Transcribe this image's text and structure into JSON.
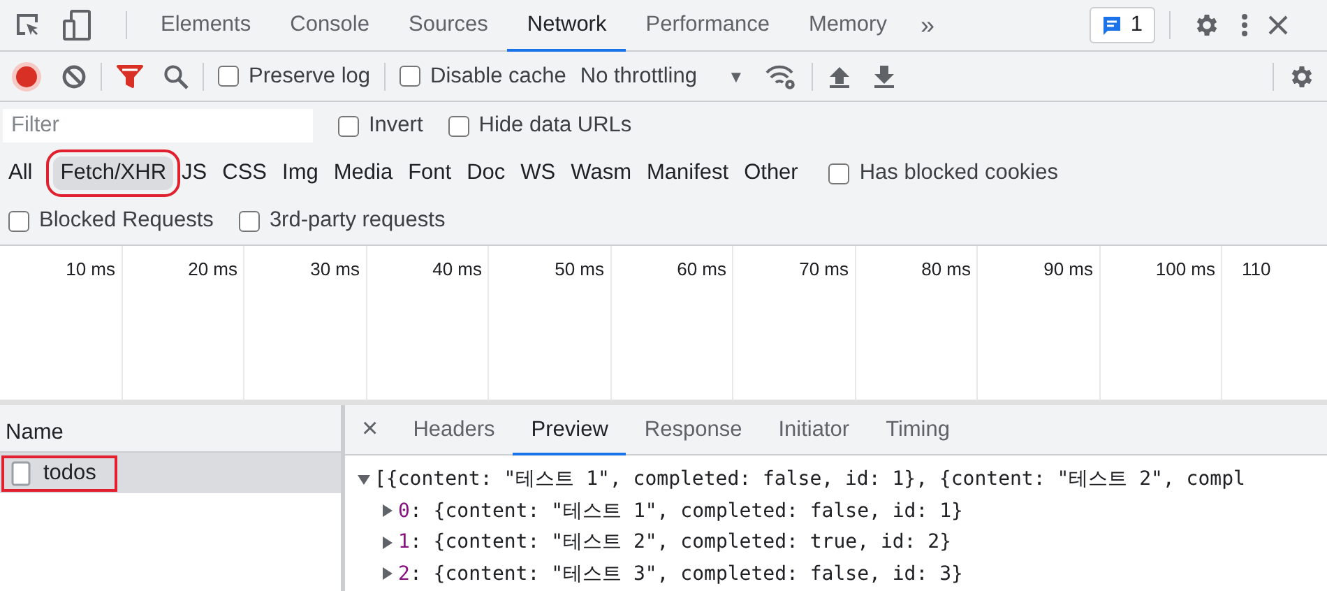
{
  "panel_tabs": [
    {
      "label": "Elements",
      "selected": false
    },
    {
      "label": "Console",
      "selected": false
    },
    {
      "label": "Sources",
      "selected": false
    },
    {
      "label": "Network",
      "selected": true
    },
    {
      "label": "Performance",
      "selected": false
    },
    {
      "label": "Memory",
      "selected": false
    }
  ],
  "more_tabs": "»",
  "issues_badge": "1",
  "toolbar": {
    "recording": true,
    "filter_active": true,
    "preserve_log": {
      "label": "Preserve log",
      "checked": false
    },
    "disable_cache": {
      "label": "Disable cache",
      "checked": false
    },
    "throttling": "No throttling",
    "dropdown_arrow": "▼"
  },
  "filter": {
    "placeholder": "Filter",
    "invert": {
      "label": "Invert",
      "checked": false
    },
    "hide_data_urls": {
      "label": "Hide data URLs",
      "checked": false
    }
  },
  "types": [
    {
      "label": "All",
      "selected": false,
      "highlighted": false
    },
    {
      "label": "Fetch/XHR",
      "selected": true,
      "highlighted": true
    },
    {
      "label": "JS",
      "selected": false,
      "highlighted": false
    },
    {
      "label": "CSS",
      "selected": false,
      "highlighted": false
    },
    {
      "label": "Img",
      "selected": false,
      "highlighted": false
    },
    {
      "label": "Media",
      "selected": false,
      "highlighted": false
    },
    {
      "label": "Font",
      "selected": false,
      "highlighted": false
    },
    {
      "label": "Doc",
      "selected": false,
      "highlighted": false
    },
    {
      "label": "WS",
      "selected": false,
      "highlighted": false
    },
    {
      "label": "Wasm",
      "selected": false,
      "highlighted": false
    },
    {
      "label": "Manifest",
      "selected": false,
      "highlighted": false
    },
    {
      "label": "Other",
      "selected": false,
      "highlighted": false
    }
  ],
  "has_blocked_cookies": {
    "label": "Has blocked cookies",
    "checked": false
  },
  "blocked_requests": {
    "label": "Blocked Requests",
    "checked": false
  },
  "third_party": {
    "label": "3rd-party requests",
    "checked": false
  },
  "timeline_ticks": [
    "10 ms",
    "20 ms",
    "30 ms",
    "40 ms",
    "50 ms",
    "60 ms",
    "70 ms",
    "80 ms",
    "90 ms",
    "100 ms",
    "110"
  ],
  "requests": {
    "column": "Name",
    "rows": [
      {
        "name": "todos",
        "selected": true,
        "highlighted": true
      }
    ]
  },
  "detail": {
    "close": "×",
    "tabs": [
      {
        "label": "Headers",
        "selected": false
      },
      {
        "label": "Preview",
        "selected": true
      },
      {
        "label": "Response",
        "selected": false
      },
      {
        "label": "Initiator",
        "selected": false
      },
      {
        "label": "Timing",
        "selected": false
      }
    ],
    "preview": {
      "expanded": true,
      "summary": "[{content: \"테스트 1\", completed: false, id: 1}, {content: \"테스트 2\", compl",
      "items": [
        {
          "index": "0",
          "text": ": {content: \"테스트 1\", completed: false, id: 1}",
          "expanded": false
        },
        {
          "index": "1",
          "text": ": {content: \"테스트 2\", completed: true, id: 2}",
          "expanded": false
        },
        {
          "index": "2",
          "text": ": {content: \"테스트 3\", completed: false, id: 3}",
          "expanded": false
        }
      ]
    }
  }
}
